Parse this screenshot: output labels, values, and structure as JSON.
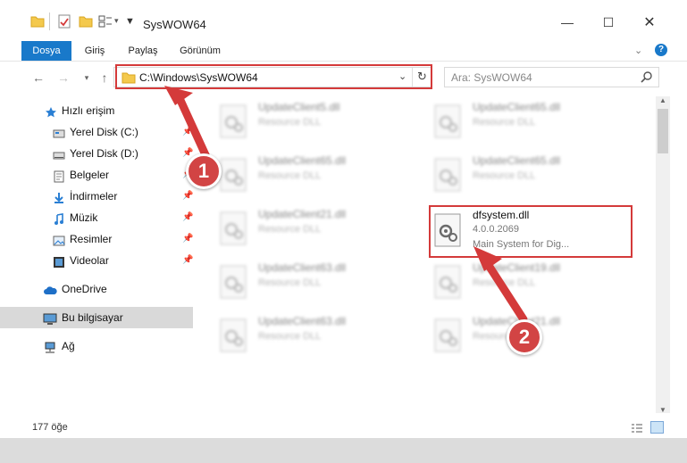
{
  "window": {
    "title": "SysWOW64",
    "controls": {
      "minimize": "—",
      "maximize": "☐",
      "close": "✕"
    }
  },
  "ribbon": {
    "tabs": [
      "Dosya",
      "Giriş",
      "Paylaş",
      "Görünüm"
    ],
    "help": "?"
  },
  "address": {
    "path": "C:\\Windows\\SysWOW64",
    "search_placeholder": "Ara: SysWOW64"
  },
  "sidebar": {
    "quick_access": "Hızlı erişim",
    "items": [
      {
        "label": "Yerel Disk (C:)",
        "icon": "drive-icon",
        "pinned": true
      },
      {
        "label": "Yerel Disk (D:)",
        "icon": "drive-icon",
        "pinned": true
      },
      {
        "label": "Belgeler",
        "icon": "documents-icon",
        "pinned": true
      },
      {
        "label": "İndirmeler",
        "icon": "download-icon",
        "pinned": true
      },
      {
        "label": "Müzik",
        "icon": "music-icon",
        "pinned": true
      },
      {
        "label": "Resimler",
        "icon": "pictures-icon",
        "pinned": true
      },
      {
        "label": "Videolar",
        "icon": "videos-icon",
        "pinned": true
      }
    ],
    "onedrive": "OneDrive",
    "this_pc": "Bu bilgisayar",
    "network": "Ağ"
  },
  "files": {
    "left": [
      {
        "name": "UpdateClient5.dll",
        "desc": "Resource DLL"
      },
      {
        "name": "UpdateClient65.dll",
        "desc": "Resource DLL"
      },
      {
        "name": "UpdateClient21.dll",
        "desc": "Resource DLL"
      },
      {
        "name": "UpdateClient63.dll",
        "desc": "Resource DLL"
      },
      {
        "name": "UpdateClient63.dll",
        "desc": "Resource DLL"
      }
    ],
    "right": [
      {
        "name": "UpdateClient65.dll",
        "desc": "Resource DLL"
      },
      {
        "name": "UpdateClient65.dll",
        "desc": "Resource DLL"
      },
      {
        "name": "UpdateClient19.dll",
        "desc": "Resource DLL"
      },
      {
        "name": "UpdateClient21.dll",
        "desc": "Resource DLL"
      }
    ],
    "highlighted": {
      "name": "dfsystem.dll",
      "version": "4.0.0.2069",
      "desc": "Main System for Dig..."
    }
  },
  "status": {
    "count": "177 öğe"
  },
  "annotations": {
    "step1": "1",
    "step2": "2"
  },
  "colors": {
    "accent": "#1979ca",
    "annotation": "#d43a3a",
    "selected": "#d9d9d9"
  }
}
